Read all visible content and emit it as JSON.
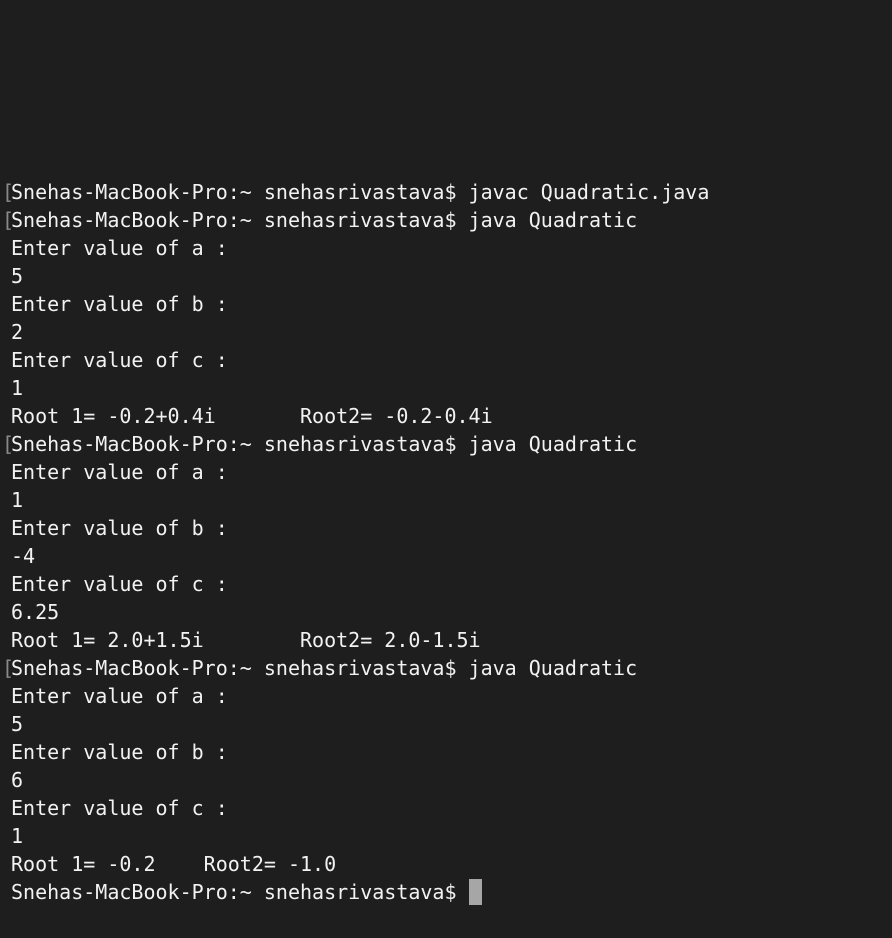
{
  "terminal": {
    "lines": [
      {
        "type": "prompt",
        "bracket": "[",
        "text": "Snehas-MacBook-Pro:~ snehasrivastava$ javac Quadratic.java"
      },
      {
        "type": "prompt",
        "bracket": "[",
        "text": "Snehas-MacBook-Pro:~ snehasrivastava$ java Quadratic"
      },
      {
        "type": "output",
        "text": "Enter value of a :"
      },
      {
        "type": "input",
        "text": "5"
      },
      {
        "type": "output",
        "text": "Enter value of b :"
      },
      {
        "type": "input",
        "text": "2"
      },
      {
        "type": "output",
        "text": "Enter value of c :"
      },
      {
        "type": "input",
        "text": "1"
      },
      {
        "type": "output",
        "text": "Root 1= -0.2+0.4i       Root2= -0.2-0.4i"
      },
      {
        "type": "prompt",
        "bracket": "[",
        "text": "Snehas-MacBook-Pro:~ snehasrivastava$ java Quadratic"
      },
      {
        "type": "output",
        "text": "Enter value of a :"
      },
      {
        "type": "input",
        "text": "1"
      },
      {
        "type": "output",
        "text": "Enter value of b :"
      },
      {
        "type": "input",
        "text": "-4"
      },
      {
        "type": "output",
        "text": "Enter value of c :"
      },
      {
        "type": "input",
        "text": "6.25"
      },
      {
        "type": "output",
        "text": "Root 1= 2.0+1.5i        Root2= 2.0-1.5i"
      },
      {
        "type": "prompt",
        "bracket": "[",
        "text": "Snehas-MacBook-Pro:~ snehasrivastava$ java Quadratic"
      },
      {
        "type": "output",
        "text": "Enter value of a :"
      },
      {
        "type": "input",
        "text": "5"
      },
      {
        "type": "output",
        "text": "Enter value of b :"
      },
      {
        "type": "input",
        "text": "6"
      },
      {
        "type": "output",
        "text": "Enter value of c :"
      },
      {
        "type": "input",
        "text": "1"
      },
      {
        "type": "output",
        "text": "Root 1= -0.2    Root2= -1.0"
      }
    ],
    "current_prompt": "Snehas-MacBook-Pro:~ snehasrivastava$ ",
    "colors": {
      "background": "#1e1e1e",
      "text": "#f2f2f2",
      "cursor": "#a6a6a6"
    }
  }
}
